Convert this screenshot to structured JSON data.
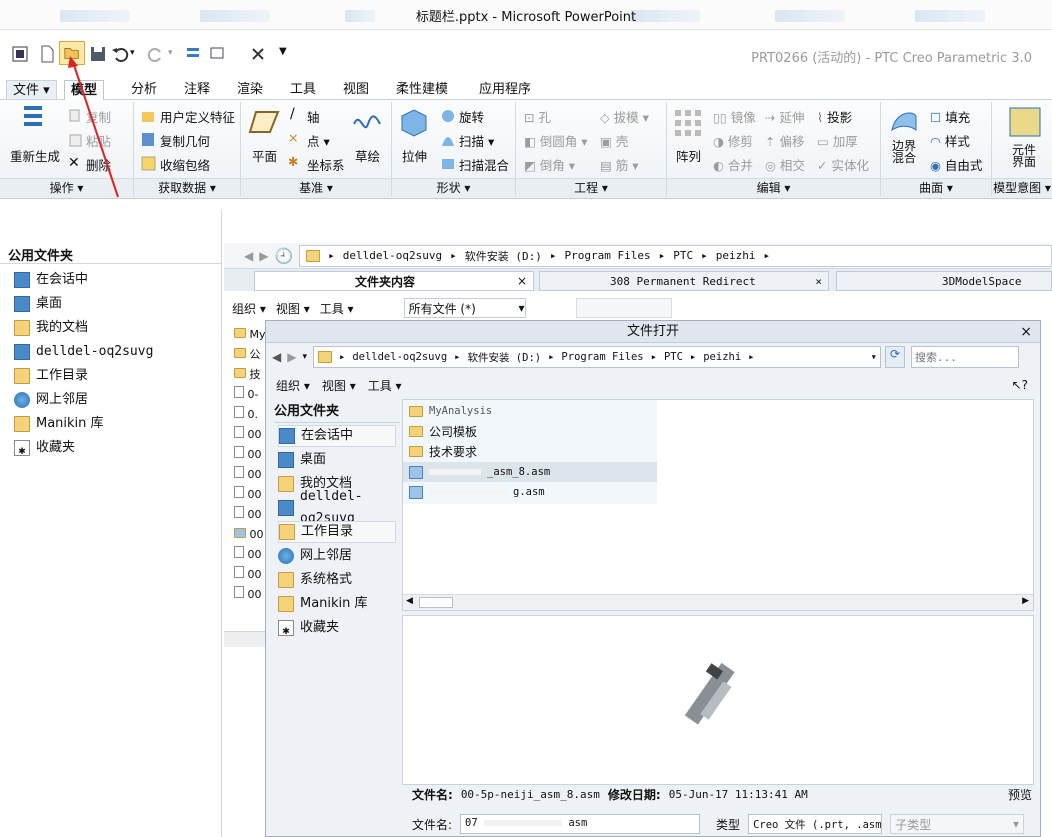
{
  "window": {
    "title": "标题栏.pptx - Microsoft PowerPoint"
  },
  "app": {
    "title": "PRT0266 (活动的) - PTC Creo Parametric 3.0"
  },
  "ribbon": {
    "tabs": [
      "文件",
      "模型",
      "分析",
      "注释",
      "渲染",
      "工具",
      "视图",
      "柔性建模",
      "应用程序"
    ],
    "active_tab": "模型",
    "groups": {
      "caozuo": {
        "label": "操作",
        "regenerate": "重新生成",
        "copy": "复制",
        "paste": "粘贴",
        "delete": "删除"
      },
      "data": {
        "label": "获取数据",
        "udf": "用户定义特征",
        "copy_geom": "复制几何",
        "shrinkwrap": "收缩包络"
      },
      "datum": {
        "label": "基准",
        "plane": "平面",
        "axis": "轴",
        "point": "点",
        "csys": "坐标系",
        "sketch": "草绘"
      },
      "shape": {
        "label": "形状",
        "extrude": "拉伸",
        "revolve": "旋转",
        "sweep": "扫描",
        "swept_blend": "扫描混合"
      },
      "eng": {
        "label": "工程",
        "hole": "孔",
        "round": "倒圆角",
        "chamfer": "倒角",
        "draft": "拔模",
        "shell": "壳",
        "rib": "筋"
      },
      "edit": {
        "label": "编辑",
        "pattern": "阵列",
        "mirror": "镜像",
        "trim": "修剪",
        "merge": "合并",
        "extend": "延伸",
        "offset": "偏移",
        "intersect": "相交",
        "project": "投影",
        "thicken": "加厚",
        "solidify": "实体化"
      },
      "surface": {
        "label": "曲面",
        "boundary": "边界混合",
        "fill": "填充",
        "style": "样式",
        "freestyle": "自由式"
      },
      "intent": {
        "label": "模型意图",
        "element_ui": "元件界面"
      }
    }
  },
  "left_pane": {
    "header": "公用文件夹",
    "items": [
      "在会话中",
      "桌面",
      "我的文档",
      "delldel-oq2suvg",
      "工作目录",
      "网上邻居",
      "Manikin 库",
      "收藏夹"
    ]
  },
  "browser": {
    "breadcrumb": [
      "delldel-oq2suvg",
      "软件安装 (D:)",
      "Program Files",
      "PTC",
      "peizhi"
    ],
    "tabs": [
      "文件夹内容",
      "308 Permanent Redirect",
      "3DModelSpace"
    ],
    "toolbar": {
      "organize": "组织",
      "view": "视图",
      "tools": "工具",
      "filter": "所有文件 (*)"
    },
    "list_stub": [
      "My",
      "公",
      "技",
      "0-",
      "0.",
      "00",
      "00",
      "00",
      "00",
      "00",
      "00",
      "00",
      "00",
      "00"
    ]
  },
  "dialog": {
    "title": "文件打开",
    "breadcrumb": [
      "delldel-oq2suvg",
      "软件安装 (D:)",
      "Program Files",
      "PTC",
      "peizhi"
    ],
    "search_placeholder": "搜索...",
    "toolbar": {
      "organize": "组织",
      "view": "视图",
      "tools": "工具"
    },
    "nav_header": "公用文件夹",
    "nav_items": [
      "在会话中",
      "桌面",
      "我的文档",
      "delldel-oq2suvg",
      "工作目录",
      "网上邻居",
      "系统格式",
      "Manikin 库",
      "收藏夹"
    ],
    "files": [
      "MyAnalysis",
      "公司模板",
      "技术要求",
      "_asm_8.asm",
      "g.asm"
    ],
    "info": {
      "name_label": "文件名:",
      "name_value": "00-5p-neiji_asm_8.asm",
      "date_label": "修改日期:",
      "date_value": "05-Jun-17 11:13:41 AM",
      "preview": "预览"
    },
    "filename_label": "文件名:",
    "filename_value": "asm",
    "type_label": "类型",
    "type_value": "Creo 文件 (.prt, .asm",
    "subtype_label": "子类型"
  }
}
